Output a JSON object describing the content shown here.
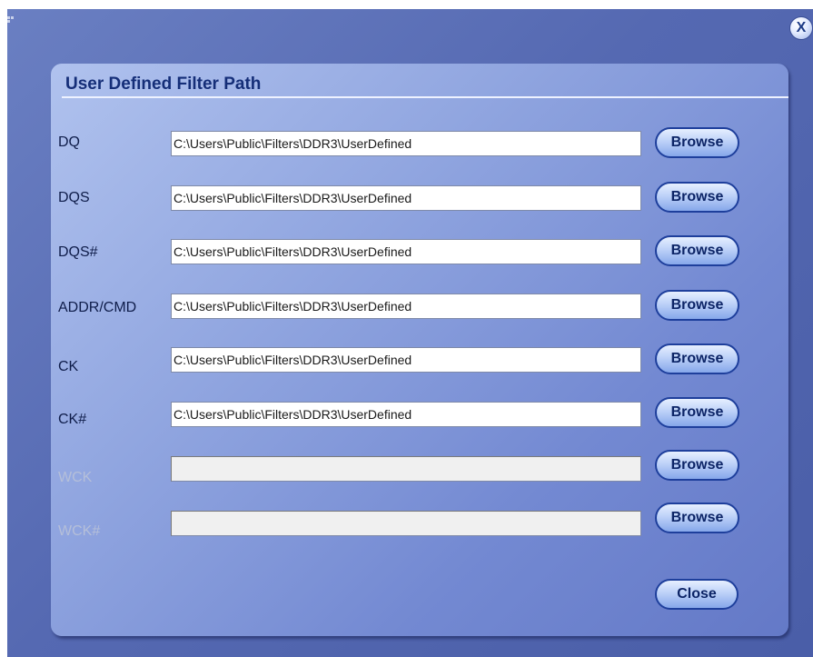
{
  "window": {
    "close_glyph": "X"
  },
  "dialog": {
    "title": "User Defined Filter Path",
    "browse_label": "Browse",
    "close_label": "Close",
    "rows": [
      {
        "label": "DQ",
        "value": "C:\\Users\\Public\\Filters\\DDR3\\UserDefined",
        "enabled": true
      },
      {
        "label": "DQS",
        "value": "C:\\Users\\Public\\Filters\\DDR3\\UserDefined",
        "enabled": true
      },
      {
        "label": "DQS#",
        "value": "C:\\Users\\Public\\Filters\\DDR3\\UserDefined",
        "enabled": true
      },
      {
        "label": "ADDR/CMD",
        "value": "C:\\Users\\Public\\Filters\\DDR3\\UserDefined",
        "enabled": true
      },
      {
        "label": "CK",
        "value": "C:\\Users\\Public\\Filters\\DDR3\\UserDefined",
        "enabled": true
      },
      {
        "label": "CK#",
        "value": "C:\\Users\\Public\\Filters\\DDR3\\UserDefined",
        "enabled": true
      },
      {
        "label": "WCK",
        "value": "",
        "enabled": false
      },
      {
        "label": "WCK#",
        "value": "",
        "enabled": false
      }
    ]
  },
  "colors": {
    "title_text": "#152e78",
    "disabled_label": "#b5bfd9",
    "button_border": "#1e3f9c"
  }
}
